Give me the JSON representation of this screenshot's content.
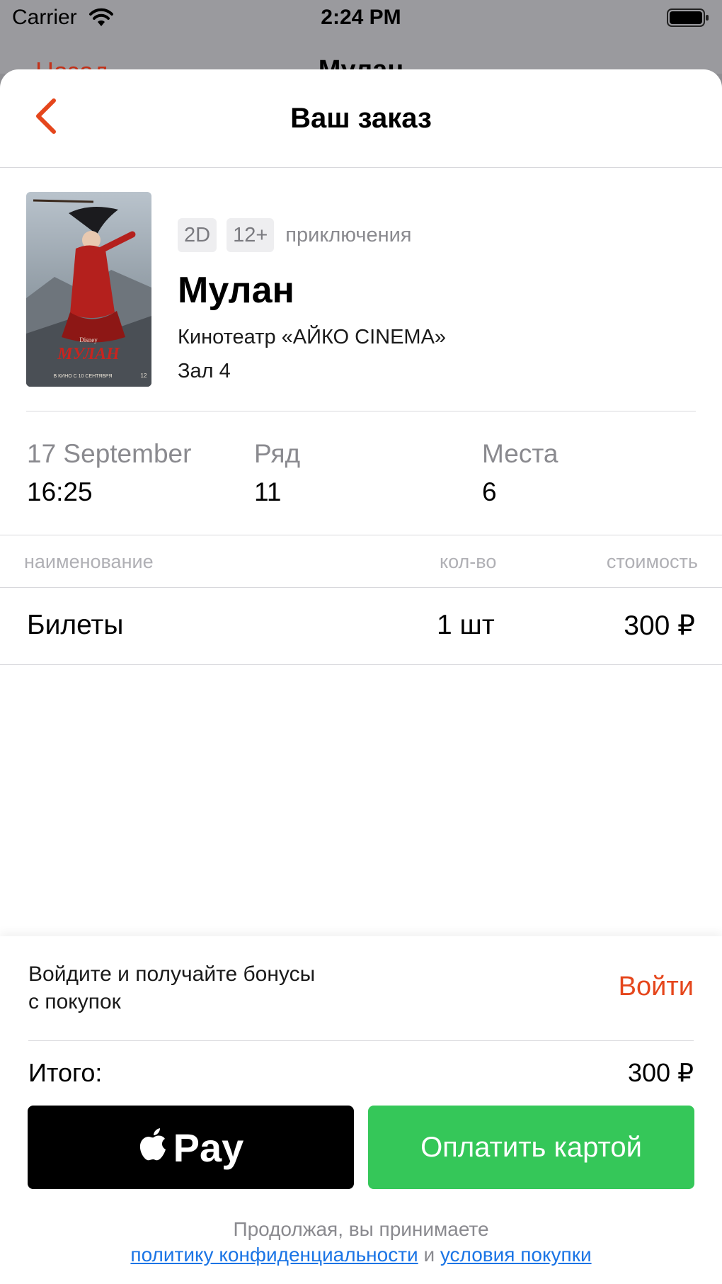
{
  "status_bar": {
    "carrier": "Carrier",
    "time": "2:24 PM"
  },
  "background_screen": {
    "left_label": "Назад",
    "title": "Мулан"
  },
  "nav": {
    "title": "Ваш заказ"
  },
  "movie": {
    "format": "2D",
    "age_rating": "12+",
    "genre": "приключения",
    "title": "Мулан",
    "cinema": "Кинотеатр «АЙКО CINEMA»",
    "hall": "Зал 4",
    "poster": {
      "logo_text": "МУЛАН",
      "studio": "Disney",
      "release_text": "В КИНО С 10 СЕНТЯБРЯ",
      "age": "12"
    }
  },
  "session": {
    "date": "17 September",
    "time": "16:25",
    "row_label": "Ряд",
    "row_value": "11",
    "seats_label": "Места",
    "seats_value": "6"
  },
  "order_table": {
    "headers": [
      "наименование",
      "кол-во",
      "стоимость"
    ],
    "rows": [
      {
        "name": "Билеты",
        "qty": "1 шт",
        "price": "300 ₽"
      }
    ]
  },
  "bonus": {
    "text_line1": "Войдите и получайте бонусы",
    "text_line2": "с покупок",
    "login_label": "Войти"
  },
  "total": {
    "label": "Итого:",
    "value": "300 ₽"
  },
  "buttons": {
    "apple_pay_label": "Pay",
    "card_pay_label": "Оплатить картой"
  },
  "legal": {
    "prefix": "Продолжая, вы принимаете",
    "privacy_link": "политику конфиденциальности",
    "conjunction": "и",
    "terms_link": "условия покупки"
  },
  "colors": {
    "accent": "#e5461c",
    "pay_green": "#35c759",
    "link_blue": "#1a74e5"
  }
}
